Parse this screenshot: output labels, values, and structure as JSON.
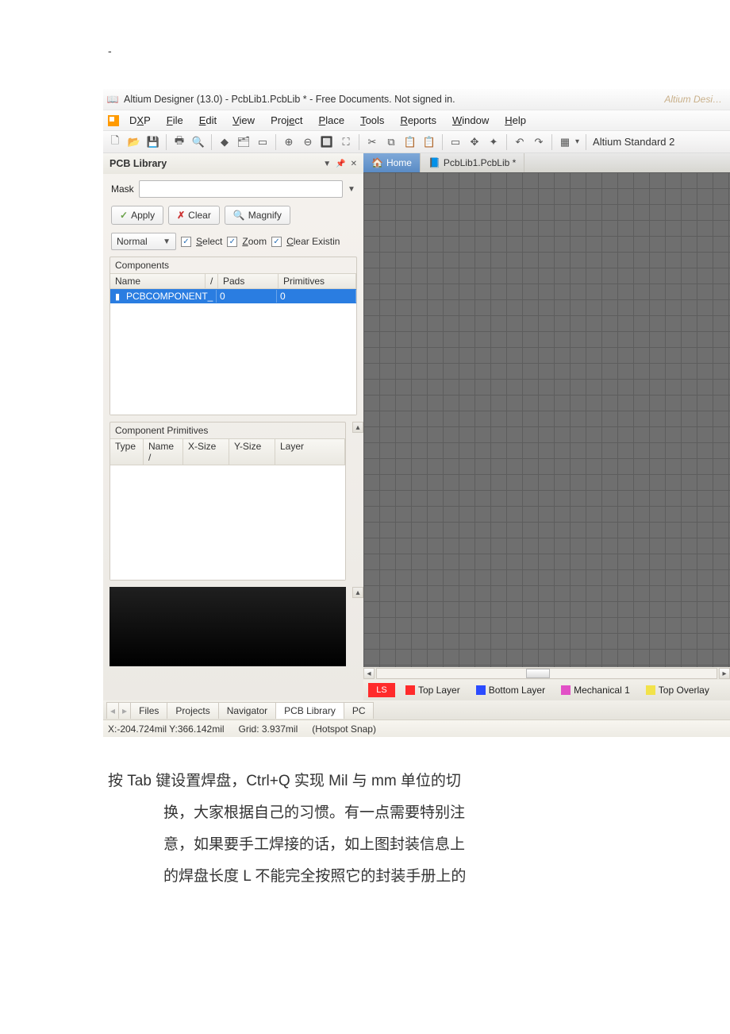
{
  "header": {
    "dash": "-"
  },
  "window": {
    "title": "Altium Designer (13.0) - PcbLib1.PcbLib * - Free Documents. Not signed in.",
    "faded_right": "Altium Desi…"
  },
  "menu": {
    "items": [
      "DXP",
      "File",
      "Edit",
      "View",
      "Project",
      "Place",
      "Tools",
      "Reports",
      "Window",
      "Help"
    ],
    "underline_idx": [
      1,
      0,
      0,
      0,
      4,
      0,
      0,
      0,
      0,
      0
    ]
  },
  "toolbar": {
    "grid_combo": "Altium Standard 2"
  },
  "panel": {
    "title": "PCB Library",
    "mask_label": "Mask",
    "apply": "Apply",
    "clear": "Clear",
    "magnify": "Magnify",
    "mode": "Normal",
    "select": "Select",
    "zoom": "Zoom",
    "clear_existing": "Clear Existin"
  },
  "components": {
    "section": "Components",
    "cols": [
      "Name",
      "Pads",
      "Primitives"
    ],
    "row": {
      "name": "PCBCOMPONENT_",
      "pads": "0",
      "primitives": "0"
    }
  },
  "primitives": {
    "section": "Component Primitives",
    "cols": [
      "Type",
      "Name",
      "X-Size",
      "Y-Size",
      "Layer"
    ]
  },
  "tabs": {
    "home": "Home",
    "doc": "PcbLib1.PcbLib *",
    "bottom": [
      "Files",
      "Projects",
      "Navigator",
      "PCB Library",
      "PC"
    ]
  },
  "layers": {
    "ls": "LS",
    "items": [
      {
        "name": "Top Layer",
        "color": "#ff2b2b"
      },
      {
        "name": "Bottom Layer",
        "color": "#2b4bff"
      },
      {
        "name": "Mechanical 1",
        "color": "#e250c6"
      },
      {
        "name": "Top Overlay",
        "color": "#f2e24a"
      }
    ]
  },
  "status": {
    "coords": "X:-204.724mil Y:366.142mil",
    "grid": "Grid: 3.937mil",
    "snap": "(Hotspot Snap)"
  },
  "note": {
    "line1": "按 Tab 键设置焊盘，Ctrl+Q 实现 Mil 与 mm 单位的切",
    "line2": "换，大家根据自己的习惯。有一点需要特别注",
    "line3": "意，如果要手工焊接的话，如上图封装信息上",
    "line4": "的焊盘长度 L 不能完全按照它的封装手册上的"
  }
}
